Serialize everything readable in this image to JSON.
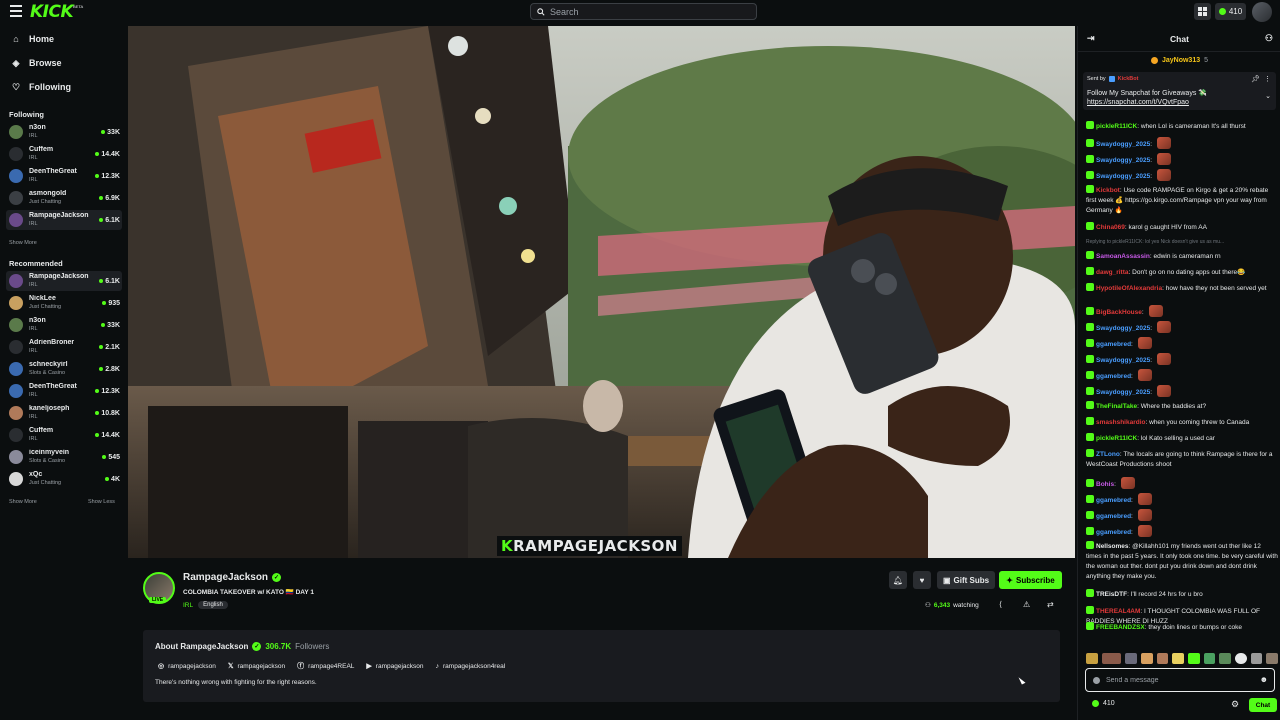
{
  "topbar": {
    "logo": "KICK",
    "logo_badge": "BETA",
    "search_placeholder": "Search",
    "points": "410"
  },
  "sidebar": {
    "nav": [
      {
        "label": "Home",
        "icon": "home-icon"
      },
      {
        "label": "Browse",
        "icon": "compass-icon"
      },
      {
        "label": "Following",
        "icon": "heart-icon"
      }
    ],
    "following_title": "Following",
    "following": [
      {
        "name": "n3on",
        "category": "IRL",
        "viewers": "33K",
        "color": "#5a7a4a"
      },
      {
        "name": "Cuffem",
        "category": "IRL",
        "viewers": "14.4K",
        "color": "#2a2d31"
      },
      {
        "name": "DeenTheGreat",
        "category": "IRL",
        "viewers": "12.3K",
        "color": "#3a6ab0"
      },
      {
        "name": "asmongold",
        "category": "Just Chatting",
        "viewers": "6.9K",
        "color": "#3b3f44"
      },
      {
        "name": "RampageJackson",
        "category": "IRL",
        "viewers": "6.1K",
        "color": "#6a4a8a"
      }
    ],
    "following_more": "Show More",
    "recommended_title": "Recommended",
    "recommended": [
      {
        "name": "RampageJackson",
        "category": "IRL",
        "viewers": "6.1K",
        "color": "#6a4a8a"
      },
      {
        "name": "NickLee",
        "category": "Just Chatting",
        "viewers": "935",
        "color": "#c8a060"
      },
      {
        "name": "n3on",
        "category": "IRL",
        "viewers": "33K",
        "color": "#5a7a4a"
      },
      {
        "name": "AdrienBroner",
        "category": "IRL",
        "viewers": "2.1K",
        "color": "#2a2d31"
      },
      {
        "name": "schneckyirl",
        "category": "Slots & Casino",
        "viewers": "2.8K",
        "color": "#3a6ab0"
      },
      {
        "name": "DeenTheGreat",
        "category": "IRL",
        "viewers": "12.3K",
        "color": "#3a6ab0"
      },
      {
        "name": "kaneljoseph",
        "category": "IRL",
        "viewers": "10.8K",
        "color": "#b07a5a"
      },
      {
        "name": "Cuffem",
        "category": "IRL",
        "viewers": "14.4K",
        "color": "#2a2d31"
      },
      {
        "name": "iceinmyvein",
        "category": "Slots & Casino",
        "viewers": "545",
        "color": "#8a8a9a"
      },
      {
        "name": "xQc",
        "category": "Just Chatting",
        "viewers": "4K",
        "color": "#d8d8d8"
      }
    ],
    "show_more": "Show More",
    "show_less": "Show Less"
  },
  "video": {
    "overlay_k": "K",
    "overlay_text": "RAMPAGEJACKSON"
  },
  "stream": {
    "live_badge": "LIVE",
    "name": "RampageJackson",
    "title": "COLOMBIA TAKEOVER w/ KATO 🇨🇴 DAY 1",
    "category": "IRL",
    "language": "English",
    "gift_label": "Gift Subs",
    "subscribe_label": "Subscribe",
    "viewers": "6,343",
    "watching_label": "watching"
  },
  "about": {
    "title": "About RampageJackson",
    "followers_count": "306.7K",
    "followers_label": "Followers",
    "socials": [
      {
        "icon": "instagram-icon",
        "glyph": "◎",
        "label": "rampagejackson"
      },
      {
        "icon": "x-icon",
        "glyph": "𝕏",
        "label": "rampagejackson"
      },
      {
        "icon": "facebook-icon",
        "glyph": "ⓕ",
        "label": "rampage4REAL"
      },
      {
        "icon": "youtube-icon",
        "glyph": "▶",
        "label": "rampagejackson"
      },
      {
        "icon": "tiktok-icon",
        "glyph": "♪",
        "label": "rampagejackson4real"
      }
    ],
    "description": "There's nothing wrong with fighting for the right reasons."
  },
  "chat": {
    "title": "Chat",
    "top_gifter": "JayNow313",
    "top_gifter_count": "5",
    "pinned_prefix": "Sent by",
    "pinned_sender": "KickBot",
    "pinned_line1": "Follow My Snapchat for Giveaways 💸",
    "pinned_link": "https://snapchat.com/t/VQvtFpao",
    "messages": [
      {
        "user": "pickleR11ICK",
        "color": "#53fc18",
        "text": "when Lol is cameraman It's all thurst",
        "emote": false
      },
      {
        "user": "Swaydoggy_2025",
        "color": "#4a9eff",
        "text": "",
        "emote": true
      },
      {
        "user": "Swaydoggy_2025",
        "color": "#4a9eff",
        "text": "",
        "emote": true
      },
      {
        "user": "Swaydoggy_2025",
        "color": "#4a9eff",
        "text": "",
        "emote": true
      },
      {
        "user": "Kickbot",
        "color": "#e23a3a",
        "text": "Use code RAMPAGE on Kirgo & get a 20% rebate first week 💰 https://go.kirgo.com/Rampage vpn your way from Germany 🔥",
        "emote": false
      },
      {
        "user": "China069",
        "color": "#e23a3a",
        "text": "karol g caught HIV from AA",
        "emote": false
      },
      {
        "user": "SamoanAssassin",
        "color": "#c85ae8",
        "text": "edwin is cameraman rn",
        "emote": false
      },
      {
        "user": "dawg_ritta",
        "color": "#e23a3a",
        "text": "Don't go on no dating apps out there😂",
        "emote": false
      },
      {
        "user": "HypotileOfAlexandria",
        "color": "#e23a3a",
        "text": "how have they not been served yet",
        "emote": false
      },
      {
        "user": "BigBackHouse",
        "color": "#e23a3a",
        "text": "",
        "emote": true
      },
      {
        "user": "Swaydoggy_2025",
        "color": "#4a9eff",
        "text": "",
        "emote": true
      },
      {
        "user": "ggamebred",
        "color": "#4a9eff",
        "text": "",
        "emote": true
      },
      {
        "user": "Swaydoggy_2025",
        "color": "#4a9eff",
        "text": "",
        "emote": true
      },
      {
        "user": "ggamebred",
        "color": "#4a9eff",
        "text": "",
        "emote": true
      },
      {
        "user": "Swaydoggy_2025",
        "color": "#4a9eff",
        "text": "",
        "emote": true
      },
      {
        "user": "TheFinalTake",
        "color": "#53fc18",
        "text": "Where the baddies at?",
        "emote": false
      },
      {
        "user": "smashshikardio",
        "color": "#e23a3a",
        "text": "when you coming threw to Canada",
        "emote": false
      },
      {
        "user": "pickleR11ICK",
        "color": "#53fc18",
        "text": "lol Kato selling a used car",
        "emote": false
      },
      {
        "user": "ZTLono",
        "color": "#4a9eff",
        "text": "The locals are going to think Rampage is there for a WestCoast Productions shoot",
        "emote": false
      },
      {
        "user": "Bohis",
        "color": "#c85ae8",
        "text": "",
        "emote": true
      },
      {
        "user": "ggamebred",
        "color": "#4a9eff",
        "text": "",
        "emote": true
      },
      {
        "user": "ggamebred",
        "color": "#4a9eff",
        "text": "",
        "emote": true
      },
      {
        "user": "ggamebred",
        "color": "#4a9eff",
        "text": "",
        "emote": true
      },
      {
        "user": "Nellsomes",
        "color": "#e8eaeb",
        "text": "@Killahh101 my friends went out ther like 12 times in the past 5 years. It only took one time. be very careful with the woman out ther. dont put you drink down and dont drink anything they make you.",
        "emote": false
      },
      {
        "user": "TREisDTF",
        "color": "#e8eaeb",
        "text": "I'll record 24 hrs for u bro",
        "emote": false
      },
      {
        "user": "THEREAL4AM",
        "color": "#e23a3a",
        "text": "I THOUGHT COLOMBIA WAS FULL OF BADDIES WHERE DI HUZZ",
        "emote": false
      },
      {
        "user": "FREEBANDZSX",
        "color": "#53fc18",
        "text": "they doin lines or bumps or coke",
        "emote": false
      }
    ],
    "reply_note": "Replying to pickleR11ICK: lol yes Nick doesn't give us as mu...",
    "input_placeholder": "Send a message",
    "points": "410",
    "send_label": "Chat"
  }
}
